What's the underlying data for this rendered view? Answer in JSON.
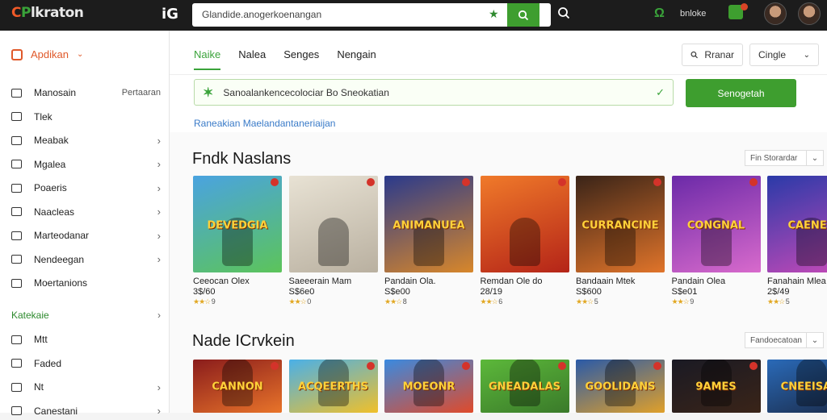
{
  "header": {
    "logo_part1": "C",
    "logo_part2": "P",
    "logo_part3": "lkraton",
    "app_icon_text": "iG",
    "search_value": "Glandide.anogerkoenangan",
    "user_label": "bnloke"
  },
  "sidebar": {
    "header": "Apdikan",
    "items": [
      {
        "label": "Manosain",
        "right": "Pertaaran"
      },
      {
        "label": "Tlek",
        "right": ""
      },
      {
        "label": "Meabak",
        "right": "›"
      },
      {
        "label": "Mgalea",
        "right": "›"
      },
      {
        "label": "Poaeris",
        "right": "›"
      },
      {
        "label": "Naacleas",
        "right": "›"
      },
      {
        "label": "Marteodanar",
        "right": "›"
      },
      {
        "label": "Nendeegan",
        "right": "›"
      },
      {
        "label": "Moertanions",
        "right": ""
      }
    ],
    "section": "Katekaie",
    "items2": [
      {
        "label": "Mtt",
        "right": ""
      },
      {
        "label": "Faded",
        "right": ""
      },
      {
        "label": "Nt",
        "right": "›"
      },
      {
        "label": "Canestani",
        "right": "›"
      }
    ]
  },
  "tabs": [
    "Naike",
    "Nalea",
    "Senges",
    "Nengain"
  ],
  "toolbar": {
    "sort_label": "Rranar",
    "dropdown_label": "Cingle"
  },
  "filter": {
    "text": "Sanoalankencecolociar  Bo Sneokatian",
    "button_label": "Senogetah"
  },
  "hint": "Raneakian Maelandantaneriaijan",
  "sections": [
    {
      "title": "Fndk Naslans",
      "button_label": "Fin Storardar",
      "cards": [
        {
          "name": "Ceeocan  Olex",
          "price": "3$/60",
          "rating": "9",
          "color1": "#4aa3e0",
          "color2": "#5cc45a",
          "art": "DEVEDGIA"
        },
        {
          "name": "Saeeerain  Mam",
          "price": "S$6e0",
          "rating": "0",
          "color1": "#e8e2d4",
          "color2": "#b9b0a0",
          "art": ""
        },
        {
          "name": "Pandain  Ola.",
          "price": "S$e00",
          "rating": "8",
          "color1": "#2a3a8c",
          "color2": "#d8872a",
          "art": "ANIMANUEA"
        },
        {
          "name": "Remdan  Ole do",
          "price": "28/19",
          "rating": "6",
          "color1": "#f07a2a",
          "color2": "#b42418",
          "art": ""
        },
        {
          "name": "Bandaain  Mtek",
          "price": "S$600",
          "rating": "5",
          "color1": "#3a2418",
          "color2": "#e0742a",
          "art": "CURRANCINE"
        },
        {
          "name": "Pandain  Olea",
          "price": "S$e01",
          "rating": "9",
          "color1": "#6b2aa8",
          "color2": "#d86acc",
          "art": "CONGNAL"
        },
        {
          "name": "Fanahain  Mlea",
          "price": "2$/49",
          "rating": "5",
          "color1": "#2a3aa8",
          "color2": "#c84ab8",
          "art": "CAENEN"
        }
      ]
    },
    {
      "title": "Nade ICrvkein",
      "button_label": "Fandoecatoan",
      "cards": [
        {
          "name": "",
          "price": "",
          "rating": "",
          "color1": "#8a1c1c",
          "color2": "#e8742a",
          "art": "CANNON"
        },
        {
          "name": "",
          "price": "",
          "rating": "",
          "color1": "#4ab0e8",
          "color2": "#f0c02a",
          "art": "ACQEERTHS"
        },
        {
          "name": "",
          "price": "",
          "rating": "",
          "color1": "#3a8ae0",
          "color2": "#e04a2a",
          "art": "MOEONR"
        },
        {
          "name": "",
          "price": "",
          "rating": "",
          "color1": "#5cb83a",
          "color2": "#3a7a2a",
          "art": "GNEADALAS"
        },
        {
          "name": "",
          "price": "",
          "rating": "",
          "color1": "#2a5aa8",
          "color2": "#e0a02a",
          "art": "GOOLIDANS"
        },
        {
          "name": "",
          "price": "",
          "rating": "",
          "color1": "#1a1a24",
          "color2": "#3a2418",
          "art": "9AMES"
        },
        {
          "name": "",
          "price": "",
          "rating": "",
          "color1": "#2a6ab8",
          "color2": "#1a2a48",
          "art": "CNEEISAIS"
        }
      ]
    }
  ],
  "colors": {
    "accent_green": "#3e9e2f",
    "accent_orange": "#e0592a",
    "link_blue": "#3a7bc8",
    "topbar": "#1c1c1c"
  }
}
